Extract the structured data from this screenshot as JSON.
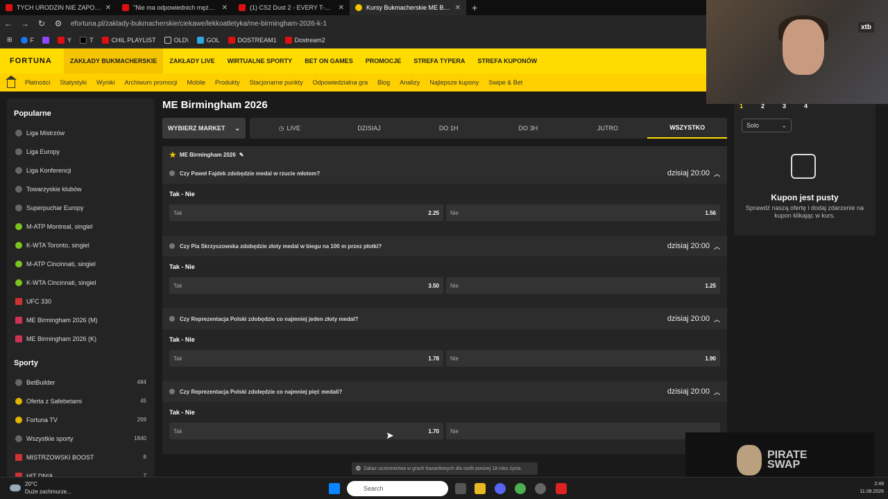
{
  "browser": {
    "tabs": [
      {
        "title": "TYCH URODZIN NIE ZAPOMNI"
      },
      {
        "title": "\"Nie ma odpowiednich mężczy"
      },
      {
        "title": "(1) CS2 Dust 2 - EVERY T-Side S"
      },
      {
        "title": "Kursy Bukmacherskie ME Birmi"
      }
    ],
    "url": "efortuna.pl/zaklady-bukmacherskie/ciekawe/lekkoatletyka/me-birmingham-2026-k-1",
    "bookmarks": [
      "F",
      "Y",
      "T",
      "CHIL PLAYLIST",
      "OLD\\",
      "GOL",
      "DOSTREAM1",
      "Dostream2"
    ]
  },
  "site": {
    "logo": "FORTUNA",
    "topnav": [
      "ZAKŁADY BUKMACHERSKIE",
      "ZAKŁADY LIVE",
      "WIRTUALNE SPORTY",
      "BET ON GAMES",
      "PROMOCJE",
      "STREFA TYPERA",
      "STREFA KUPONÓW"
    ],
    "subnav": [
      "Płatności",
      "Statystyki",
      "Wyniki",
      "Archiwum promocji",
      "Mobile",
      "Produkty",
      "Stacjonarne punkty",
      "Odpowiedzialna gra",
      "Blog",
      "Analizy",
      "Najlepsze kupony",
      "Swipe & Bet"
    ]
  },
  "sidebar": {
    "popular_title": "Popularne",
    "popular": [
      "Liga Mistrzów",
      "Liga Europy",
      "Liga Konferencji",
      "Towarzyskie klubów",
      "Superpuchar Europy",
      "M-ATP Montreal, singiel",
      "K-WTA Toronto, singiel",
      "M-ATP Cincinnati, singiel",
      "K-WTA Cincinnati, singiel",
      "UFC 330",
      "ME Birmingham 2026 (M)",
      "ME Birmingham 2026 (K)"
    ],
    "sports_title": "Sporty",
    "sports": [
      {
        "label": "BetBuilder",
        "count": "484"
      },
      {
        "label": "Oferta z Safebetami",
        "count": "45"
      },
      {
        "label": "Fortuna TV",
        "count": "269"
      },
      {
        "label": "Wszystkie sporty",
        "count": "1840"
      },
      {
        "label": "MISTRZOWSKI BOOST",
        "count": "8"
      },
      {
        "label": "HIT DNIA",
        "count": "7"
      }
    ]
  },
  "main": {
    "title": "ME Birmingham 2026",
    "market_label": "WYBIERZ MARKET",
    "filters": [
      "LIVE",
      "DZISIAJ",
      "DO 1H",
      "DO 3H",
      "JUTRO",
      "WSZYSTKO"
    ],
    "competition": "ME Birmingham 2026",
    "events": [
      {
        "question": "Czy Paweł Fajdek zdobędzie medal w rzucie młotem?",
        "time": "dzisiaj 20:00",
        "market": "Tak - Nie",
        "yes_label": "Tak",
        "yes_odd": "2.25",
        "no_label": "Nie",
        "no_odd": "1.56"
      },
      {
        "question": "Czy Pia Skrzyszowska zdobędzie złoty medal w biegu na 100 m przez płotki?",
        "time": "dzisiaj 20:00",
        "market": "Tak - Nie",
        "yes_label": "Tak",
        "yes_odd": "3.50",
        "no_label": "Nie",
        "no_odd": "1.25"
      },
      {
        "question": "Czy Reprezentacja Polski zdobędzie co najmniej jeden złoty medal?",
        "time": "dzisiaj 20:00",
        "market": "Tak - Nie",
        "yes_label": "Tak",
        "yes_odd": "1.78",
        "no_label": "Nie",
        "no_odd": "1.90"
      },
      {
        "question": "Czy Reprezentacja Polski zdobędzie co najmniej pięć medali?",
        "time": "dzisiaj 20:00",
        "market": "Tak - Nie",
        "yes_label": "Tak",
        "yes_odd": "1.70",
        "no_label": "Nie",
        "no_odd": ""
      }
    ]
  },
  "coupon": {
    "tabs": [
      "1",
      "2",
      "3",
      "4"
    ],
    "mode": "Solo",
    "title": "Kupon jest pusty",
    "subtitle": "Sprawdź naszą ofertę i dodaj zdarzenie na kupon klikając w kurs."
  },
  "overlay": {
    "webcam_brand": "xtb",
    "sponsor": "PIRATE SWAP",
    "notice": "Zakaz uczestnictwa w grach hazardowych dla osób poniżej 18 roku życia."
  },
  "taskbar": {
    "temp": "20°C",
    "weather": "Duże zachmurze...",
    "search": "Search",
    "time": "2:49",
    "date": "11.08.2026"
  }
}
